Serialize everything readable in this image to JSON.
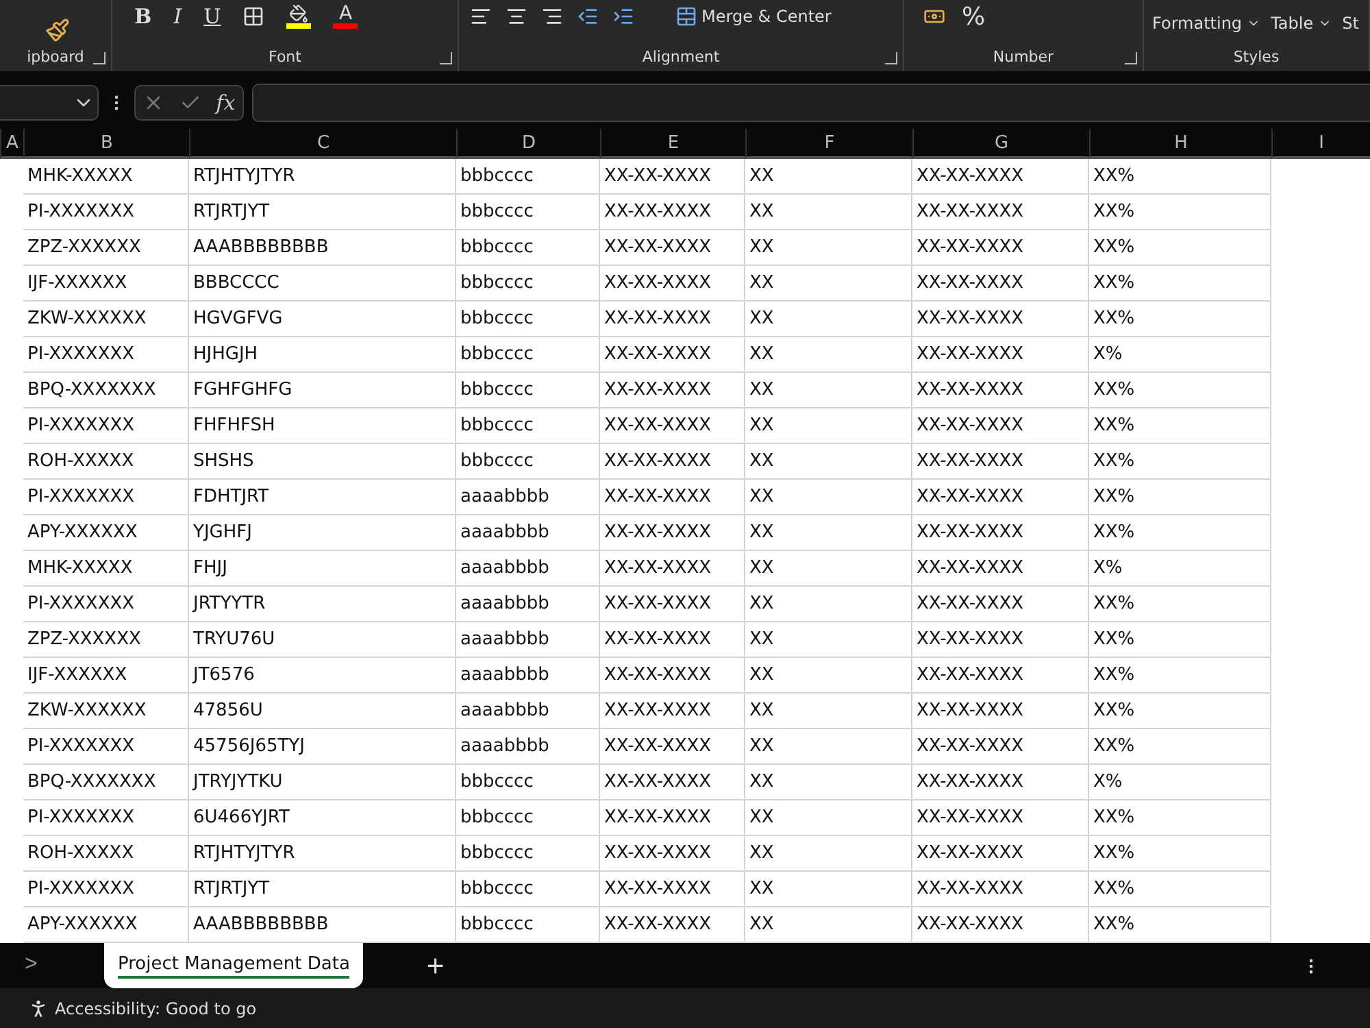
{
  "ribbon": {
    "groups": [
      {
        "kind": "clipboard",
        "label": "ipboard"
      },
      {
        "kind": "font",
        "label": "Font",
        "buttons": [
          "B",
          "I",
          "U"
        ],
        "font_color": "A"
      },
      {
        "kind": "alignment",
        "label": "Alignment",
        "merge": "Merge & Center"
      },
      {
        "kind": "number",
        "label": "Number",
        "buttons": [
          "%"
        ]
      },
      {
        "kind": "styles",
        "label": "Styles",
        "buttons": [
          "Formatting",
          "Table",
          "St"
        ]
      }
    ]
  },
  "formula_bar": {
    "fx": "fx"
  },
  "columns": [
    "A",
    "B",
    "C",
    "D",
    "E",
    "F",
    "G",
    "H",
    "I"
  ],
  "rows": [
    [
      "MHK-XXXXX",
      "RTJHTYJTYR",
      "bbbcccc",
      "XX-XX-XXXX",
      "XX",
      "XX-XX-XXXX",
      "XX%"
    ],
    [
      "PI-XXXXXXX",
      "RTJRTJYT",
      "bbbcccc",
      "XX-XX-XXXX",
      "XX",
      "XX-XX-XXXX",
      "XX%"
    ],
    [
      "ZPZ-XXXXXX",
      "AAABBBBBBBB",
      "bbbcccc",
      "XX-XX-XXXX",
      "XX",
      "XX-XX-XXXX",
      "XX%"
    ],
    [
      "IJF-XXXXXX",
      "BBBCCCC",
      "bbbcccc",
      "XX-XX-XXXX",
      "XX",
      "XX-XX-XXXX",
      "XX%"
    ],
    [
      "ZKW-XXXXXX",
      "HGVGFVG",
      "bbbcccc",
      "XX-XX-XXXX",
      "XX",
      "XX-XX-XXXX",
      "XX%"
    ],
    [
      "PI-XXXXXXX",
      "HJHGJH",
      "bbbcccc",
      "XX-XX-XXXX",
      "XX",
      "XX-XX-XXXX",
      "X%"
    ],
    [
      "BPQ-XXXXXXX",
      "FGHFGHFG",
      "bbbcccc",
      "XX-XX-XXXX",
      "XX",
      "XX-XX-XXXX",
      "XX%"
    ],
    [
      "PI-XXXXXXX",
      "FHFHFSH",
      "bbbcccc",
      "XX-XX-XXXX",
      "XX",
      "XX-XX-XXXX",
      "XX%"
    ],
    [
      "ROH-XXXXX",
      "SHSHS",
      "bbbcccc",
      "XX-XX-XXXX",
      "XX",
      "XX-XX-XXXX",
      "XX%"
    ],
    [
      "PI-XXXXXXX",
      "FDHTJRT",
      "aaaabbbb",
      "XX-XX-XXXX",
      "XX",
      "XX-XX-XXXX",
      "XX%"
    ],
    [
      "APY-XXXXXX",
      "YJGHFJ",
      "aaaabbbb",
      "XX-XX-XXXX",
      "XX",
      "XX-XX-XXXX",
      "XX%"
    ],
    [
      "MHK-XXXXX",
      "FHJJ",
      "aaaabbbb",
      "XX-XX-XXXX",
      "XX",
      "XX-XX-XXXX",
      "X%"
    ],
    [
      "PI-XXXXXXX",
      "JRTYYTR",
      "aaaabbbb",
      "XX-XX-XXXX",
      "XX",
      "XX-XX-XXXX",
      "XX%"
    ],
    [
      "ZPZ-XXXXXX",
      "TRYU76U",
      "aaaabbbb",
      "XX-XX-XXXX",
      "XX",
      "XX-XX-XXXX",
      "XX%"
    ],
    [
      "IJF-XXXXXX",
      "JT6576",
      "aaaabbbb",
      "XX-XX-XXXX",
      "XX",
      "XX-XX-XXXX",
      "XX%"
    ],
    [
      "ZKW-XXXXXX",
      "47856U",
      "aaaabbbb",
      "XX-XX-XXXX",
      "XX",
      "XX-XX-XXXX",
      "XX%"
    ],
    [
      "PI-XXXXXXX",
      "45756J65TYJ",
      "aaaabbbb",
      "XX-XX-XXXX",
      "XX",
      "XX-XX-XXXX",
      "XX%"
    ],
    [
      "BPQ-XXXXXXX",
      "JTRYJYTKU",
      "bbbcccc",
      "XX-XX-XXXX",
      "XX",
      "XX-XX-XXXX",
      "X%"
    ],
    [
      "PI-XXXXXXX",
      "6U466YJRT",
      "bbbcccc",
      "XX-XX-XXXX",
      "XX",
      "XX-XX-XXXX",
      "XX%"
    ],
    [
      "ROH-XXXXX",
      "RTJHTYJTYR",
      "bbbcccc",
      "XX-XX-XXXX",
      "XX",
      "XX-XX-XXXX",
      "XX%"
    ],
    [
      "PI-XXXXXXX",
      "RTJRTJYT",
      "bbbcccc",
      "XX-XX-XXXX",
      "XX",
      "XX-XX-XXXX",
      "XX%"
    ],
    [
      "APY-XXXXXX",
      "AAABBBBBBBB",
      "bbbcccc",
      "XX-XX-XXXX",
      "XX",
      "XX-XX-XXXX",
      "XX%"
    ]
  ],
  "sheet_tabs": {
    "nav": ">",
    "tabs": [
      {
        "label": "Project Management Data",
        "selected": true
      }
    ],
    "add": "+"
  },
  "status_bar": {
    "accessibility": "Accessibility: Good to go"
  }
}
